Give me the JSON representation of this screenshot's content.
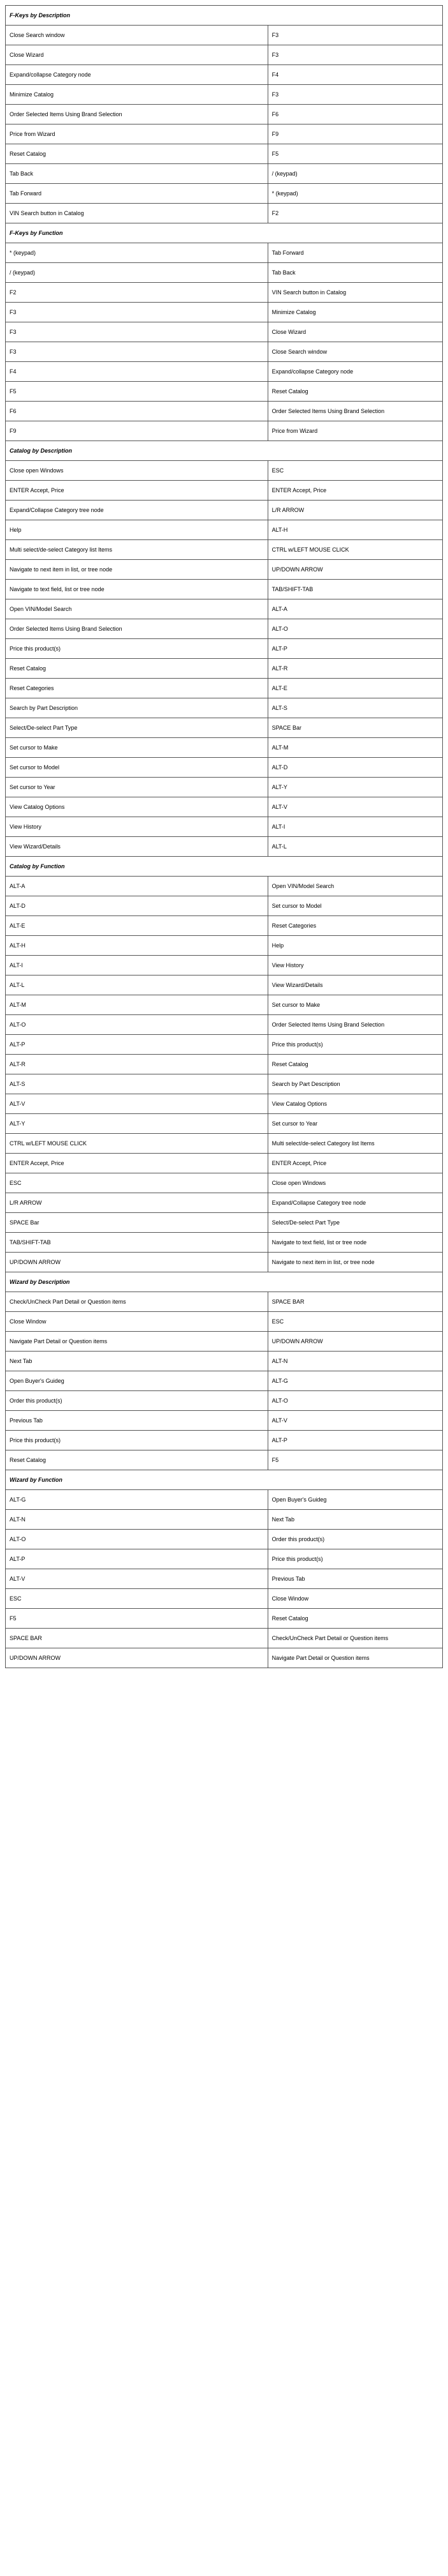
{
  "sections": [
    {
      "title": "F-Keys by Description",
      "rows": [
        {
          "left": "Close Search window",
          "right": "F3"
        },
        {
          "left": "Close Wizard",
          "right": "F3"
        },
        {
          "left": "Expand/collapse Category node",
          "right": "F4"
        },
        {
          "left": "Minimize Catalog",
          "right": "F3"
        },
        {
          "left": "Order Selected Items Using Brand Selection",
          "right": "F6"
        },
        {
          "left": "Price from Wizard",
          "right": "F9"
        },
        {
          "left": "Reset Catalog",
          "right": "F5"
        },
        {
          "left": "Tab Back",
          "right": " / (keypad)"
        },
        {
          "left": "Tab Forward",
          "right": " * (keypad)"
        },
        {
          "left": "VIN Search button in Catalog",
          "right": "F2"
        }
      ]
    },
    {
      "title": "F-Keys by Function",
      "rows": [
        {
          "left": " * (keypad)",
          "right": "Tab Forward"
        },
        {
          "left": " / (keypad)",
          "right": "Tab Back"
        },
        {
          "left": "F2",
          "right": "VIN Search button in Catalog"
        },
        {
          "left": "F3",
          "right": "Minimize Catalog"
        },
        {
          "left": "F3",
          "right": "Close Wizard"
        },
        {
          "left": "F3",
          "right": "Close Search window"
        },
        {
          "left": "F4",
          "right": "Expand/collapse Category node"
        },
        {
          "left": "F5",
          "right": "Reset Catalog"
        },
        {
          "left": "F6",
          "right": "Order Selected Items Using Brand Selection"
        },
        {
          "left": "F9",
          "right": "Price from Wizard"
        }
      ]
    },
    {
      "title": "Catalog  by Description",
      "rows": [
        {
          "left": "Close open Windows",
          "right": "ESC"
        },
        {
          "left": "ENTER Accept, Price",
          "right": "ENTER Accept, Price"
        },
        {
          "left": "Expand/Collapse Category tree node",
          "right": "L/R ARROW"
        },
        {
          "left": "Help",
          "right": "ALT-H"
        },
        {
          "left": "Multi select/de-select Category list Items",
          "right": "CTRL w/LEFT MOUSE CLICK"
        },
        {
          "left": "Navigate to next item in list, or tree node",
          "right": "UP/DOWN ARROW"
        },
        {
          "left": "Navigate to text field, list or tree node",
          "right": "TAB/SHIFT-TAB"
        },
        {
          "left": "Open VIN/Model Search",
          "right": "ALT-A"
        },
        {
          "left": "Order Selected Items Using Brand Selection",
          "right": "ALT-O"
        },
        {
          "left": "Price this product(s)",
          "right": "ALT-P"
        },
        {
          "left": "Reset Catalog",
          "right": "ALT-R"
        },
        {
          "left": "Reset Categories",
          "right": "ALT-E"
        },
        {
          "left": "Search by Part Description",
          "right": "ALT-S"
        },
        {
          "left": "Select/De-select Part Type",
          "right": "SPACE Bar"
        },
        {
          "left": "Set cursor to Make",
          "right": "ALT-M"
        },
        {
          "left": "Set cursor to Model",
          "right": "ALT-D"
        },
        {
          "left": "Set cursor to Year",
          "right": "ALT-Y"
        },
        {
          "left": "View Catalog  Options",
          "right": "ALT-V"
        },
        {
          "left": "View History",
          "right": "ALT-I"
        },
        {
          "left": "View Wizard/Details",
          "right": "ALT-L"
        }
      ]
    },
    {
      "title": "Catalog by Function",
      "rows": [
        {
          "left": "ALT-A",
          "right": "Open VIN/Model Search"
        },
        {
          "left": "ALT-D",
          "right": "Set cursor to Model"
        },
        {
          "left": "ALT-E",
          "right": "Reset Categories"
        },
        {
          "left": "ALT-H",
          "right": "Help"
        },
        {
          "left": "ALT-I",
          "right": "View History"
        },
        {
          "left": "ALT-L",
          "right": "View Wizard/Details"
        },
        {
          "left": "ALT-M",
          "right": "Set cursor to Make"
        },
        {
          "left": "ALT-O",
          "right": "Order Selected Items Using Brand Selection"
        },
        {
          "left": "ALT-P",
          "right": "Price this product(s)"
        },
        {
          "left": "ALT-R",
          "right": "Reset Catalog"
        },
        {
          "left": "ALT-S",
          "right": "Search by Part Description"
        },
        {
          "left": "ALT-V",
          "right": "View Catalog  Options"
        },
        {
          "left": "ALT-Y",
          "right": "Set cursor to Year"
        },
        {
          "left": "CTRL w/LEFT MOUSE CLICK",
          "right": "Multi select/de-select Category list Items"
        },
        {
          "left": "ENTER Accept, Price",
          "right": "ENTER Accept, Price"
        },
        {
          "left": "ESC",
          "right": "Close open Windows"
        },
        {
          "left": "L/R ARROW",
          "right": "Expand/Collapse Category tree node"
        },
        {
          "left": "SPACE Bar",
          "right": "Select/De-select Part Type"
        },
        {
          "left": "TAB/SHIFT-TAB",
          "right": "Navigate to text field, list or tree node"
        },
        {
          "left": "UP/DOWN ARROW",
          "right": "Navigate to next item in list, or tree node"
        }
      ]
    },
    {
      "title": "Wizard by Description",
      "rows": [
        {
          "left": "Check/UnCheck Part Detail or Question items",
          "right": "SPACE BAR"
        },
        {
          "left": "Close Window",
          "right": "ESC"
        },
        {
          "left": "Navigate Part Detail or Question items",
          "right": "UP/DOWN ARROW"
        },
        {
          "left": "Next Tab",
          "right": "ALT-N"
        },
        {
          "left": "Open Buyer's Guideg",
          "right": "ALT-G"
        },
        {
          "left": "Order this product(s)",
          "right": "ALT-O"
        },
        {
          "left": "Previous Tab",
          "right": "ALT-V"
        },
        {
          "left": "Price this product(s)",
          "right": "ALT-P"
        },
        {
          "left": "Reset Catalog",
          "right": "F5"
        }
      ]
    },
    {
      "title": "Wizard by Function",
      "rows": [
        {
          "left": "ALT-G",
          "right": "Open Buyer's Guideg"
        },
        {
          "left": "ALT-N",
          "right": "Next Tab"
        },
        {
          "left": "ALT-O",
          "right": "Order this product(s)"
        },
        {
          "left": "ALT-P",
          "right": "Price this product(s)"
        },
        {
          "left": "ALT-V",
          "right": "Previous Tab"
        },
        {
          "left": "ESC",
          "right": "Close Window"
        },
        {
          "left": "F5",
          "right": "Reset Catalog"
        },
        {
          "left": "SPACE BAR",
          "right": "Check/UnCheck Part Detail or Question items"
        },
        {
          "left": "UP/DOWN ARROW",
          "right": "Navigate Part Detail or Question items"
        }
      ]
    }
  ]
}
